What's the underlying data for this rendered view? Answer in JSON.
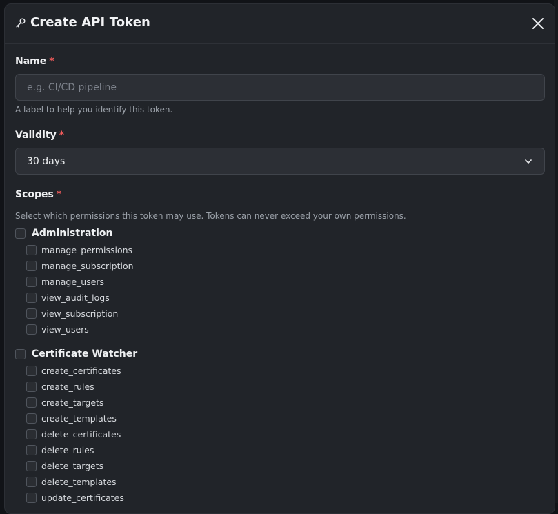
{
  "modal": {
    "title": "Create API Token",
    "title_icon": "key-icon",
    "close_icon": "close-icon"
  },
  "name_field": {
    "label": "Name",
    "required_mark": "*",
    "placeholder": "e.g. CI/CD pipeline",
    "value": "",
    "help": "A label to help you identify this token."
  },
  "validity_field": {
    "label": "Validity",
    "required_mark": "*",
    "selected": "30 days",
    "icon": "chevron-down-icon"
  },
  "scopes": {
    "label": "Scopes",
    "required_mark": "*",
    "help": "Select which permissions this token may use. Tokens can never exceed your own permissions.",
    "groups": [
      {
        "label": "Administration",
        "items": [
          "manage_permissions",
          "manage_subscription",
          "manage_users",
          "view_audit_logs",
          "view_subscription",
          "view_users"
        ]
      },
      {
        "label": "Certificate Watcher",
        "items": [
          "create_certificates",
          "create_rules",
          "create_targets",
          "create_templates",
          "delete_certificates",
          "delete_rules",
          "delete_targets",
          "delete_templates",
          "update_certificates"
        ]
      }
    ]
  },
  "colors": {
    "modal_bg": "#212429",
    "input_bg": "#2c2f35",
    "required": "#ef5a5a"
  }
}
